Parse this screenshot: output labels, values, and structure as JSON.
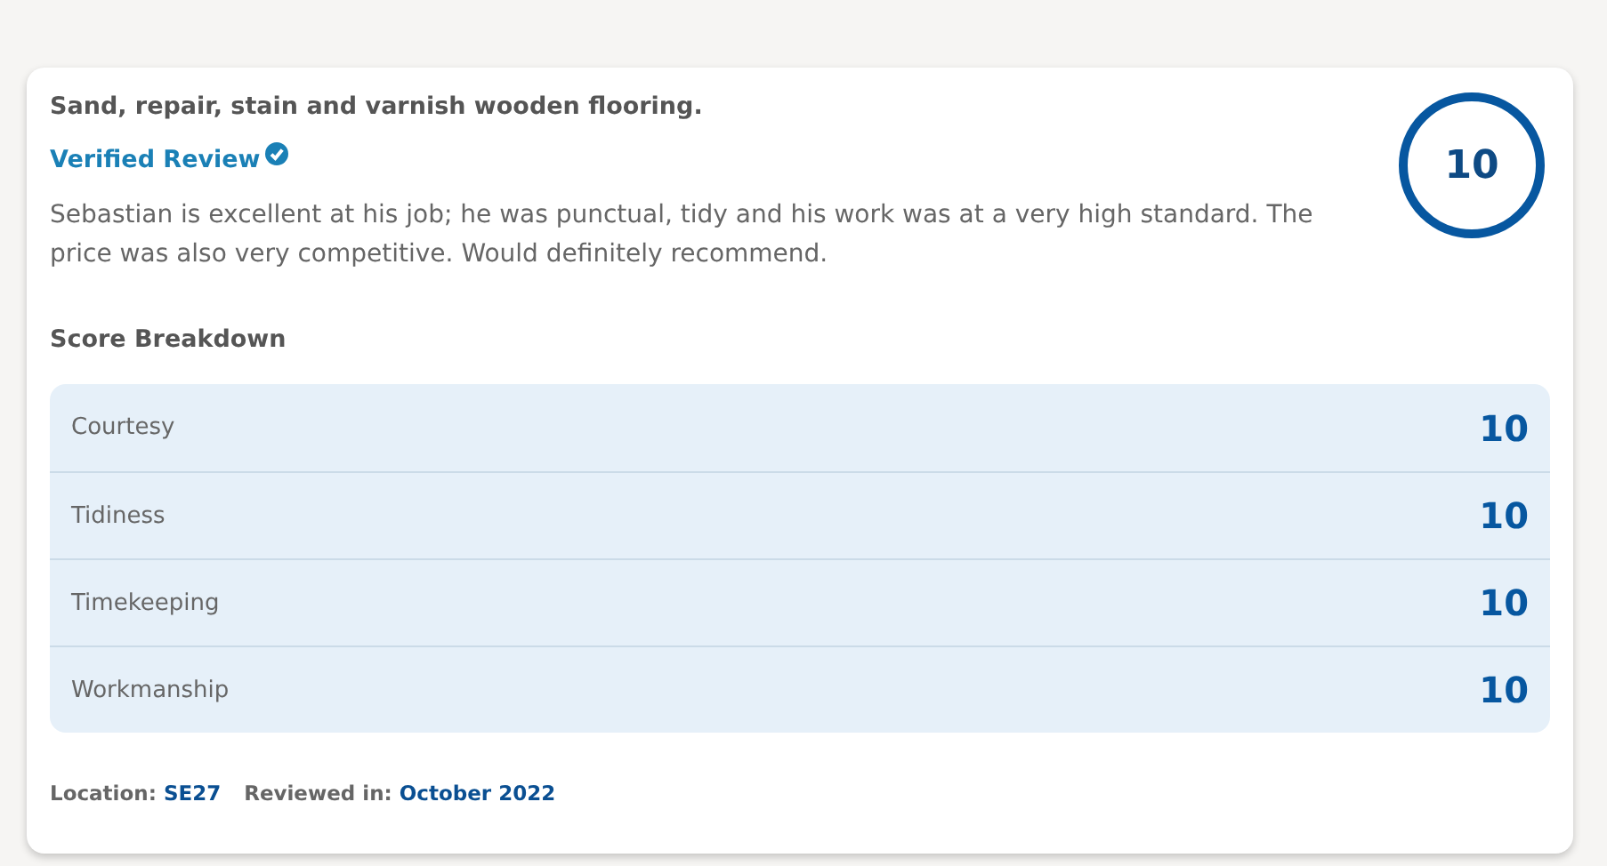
{
  "review": {
    "title": "Sand, repair, stain and varnish wooden flooring.",
    "verified_label": "Verified Review",
    "body": "Sebastian is excellent at his job; he was punctual, tidy and his work was at a very high standard. The price was also very competitive. Would definitely recommend.",
    "overall_score": "10"
  },
  "breakdown": {
    "heading": "Score Breakdown",
    "rows": [
      {
        "label": "Courtesy",
        "score": "10"
      },
      {
        "label": "Tidiness",
        "score": "10"
      },
      {
        "label": "Timekeeping",
        "score": "10"
      },
      {
        "label": "Workmanship",
        "score": "10"
      }
    ]
  },
  "footer": [
    {
      "label": "Location:",
      "value": "SE27"
    },
    {
      "label": "Reviewed in:",
      "value": "October 2022"
    }
  ]
}
